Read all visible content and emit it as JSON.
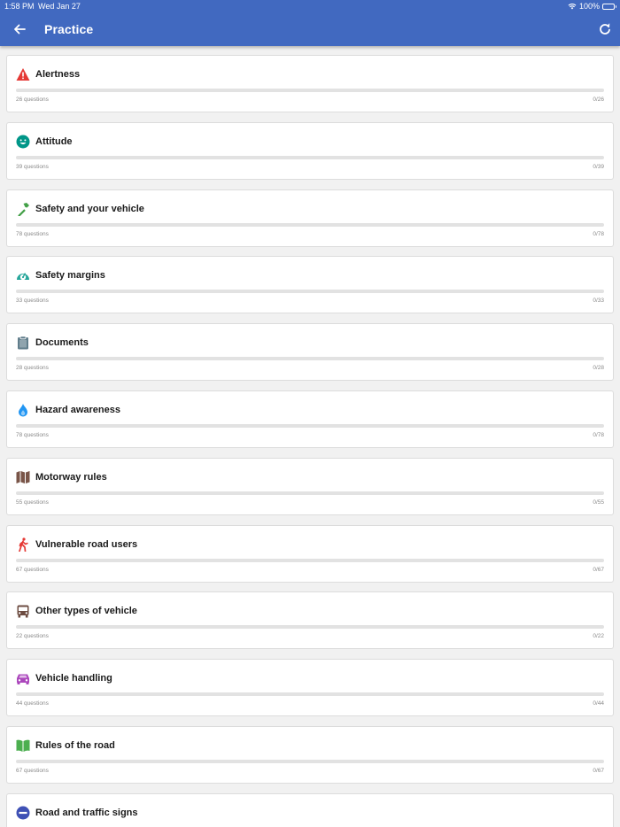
{
  "status_bar": {
    "time": "1:58 PM",
    "date": "Wed Jan 27",
    "battery": "100%"
  },
  "header": {
    "title": "Practice",
    "back_icon": "arrow-left-icon",
    "refresh_icon": "refresh-icon"
  },
  "colors": {
    "header": "#4169c0",
    "progress_track": "#e2e2e2"
  },
  "categories": [
    {
      "title": "Alertness",
      "questions": "26 questions",
      "score": "0/26",
      "icon": "warning-icon",
      "icon_color": "#e53935",
      "progress": 0
    },
    {
      "title": "Attitude",
      "questions": "39 questions",
      "score": "0/39",
      "icon": "smiley-icon",
      "icon_color": "#009688",
      "progress": 0
    },
    {
      "title": "Safety and your vehicle",
      "questions": "78 questions",
      "score": "0/78",
      "icon": "hammer-icon",
      "icon_color": "#43a047",
      "progress": 0
    },
    {
      "title": "Safety margins",
      "questions": "33 questions",
      "score": "0/33",
      "icon": "speedometer-icon",
      "icon_color": "#26a69a",
      "progress": 0
    },
    {
      "title": "Documents",
      "questions": "28 questions",
      "score": "0/28",
      "icon": "clipboard-icon",
      "icon_color": "#607d8b",
      "progress": 0
    },
    {
      "title": "Hazard awareness",
      "questions": "78 questions",
      "score": "0/78",
      "icon": "flame-icon",
      "icon_color": "#2196f3",
      "progress": 0
    },
    {
      "title": "Motorway rules",
      "questions": "55 questions",
      "score": "0/55",
      "icon": "map-icon",
      "icon_color": "#795548",
      "progress": 0
    },
    {
      "title": "Vulnerable road users",
      "questions": "67 questions",
      "score": "0/67",
      "icon": "walking-person-icon",
      "icon_color": "#e53935",
      "progress": 0
    },
    {
      "title": "Other types of vehicle",
      "questions": "22 questions",
      "score": "0/22",
      "icon": "bus-icon",
      "icon_color": "#6d4c41",
      "progress": 0
    },
    {
      "title": "Vehicle handling",
      "questions": "44 questions",
      "score": "0/44",
      "icon": "car-icon",
      "icon_color": "#ab47bc",
      "progress": 0
    },
    {
      "title": "Rules of the road",
      "questions": "67 questions",
      "score": "0/67",
      "icon": "book-icon",
      "icon_color": "#4caf50",
      "progress": 0
    },
    {
      "title": "Road and traffic signs",
      "questions": "",
      "score": "",
      "icon": "no-entry-icon",
      "icon_color": "#3f51b5",
      "progress": 0
    }
  ]
}
